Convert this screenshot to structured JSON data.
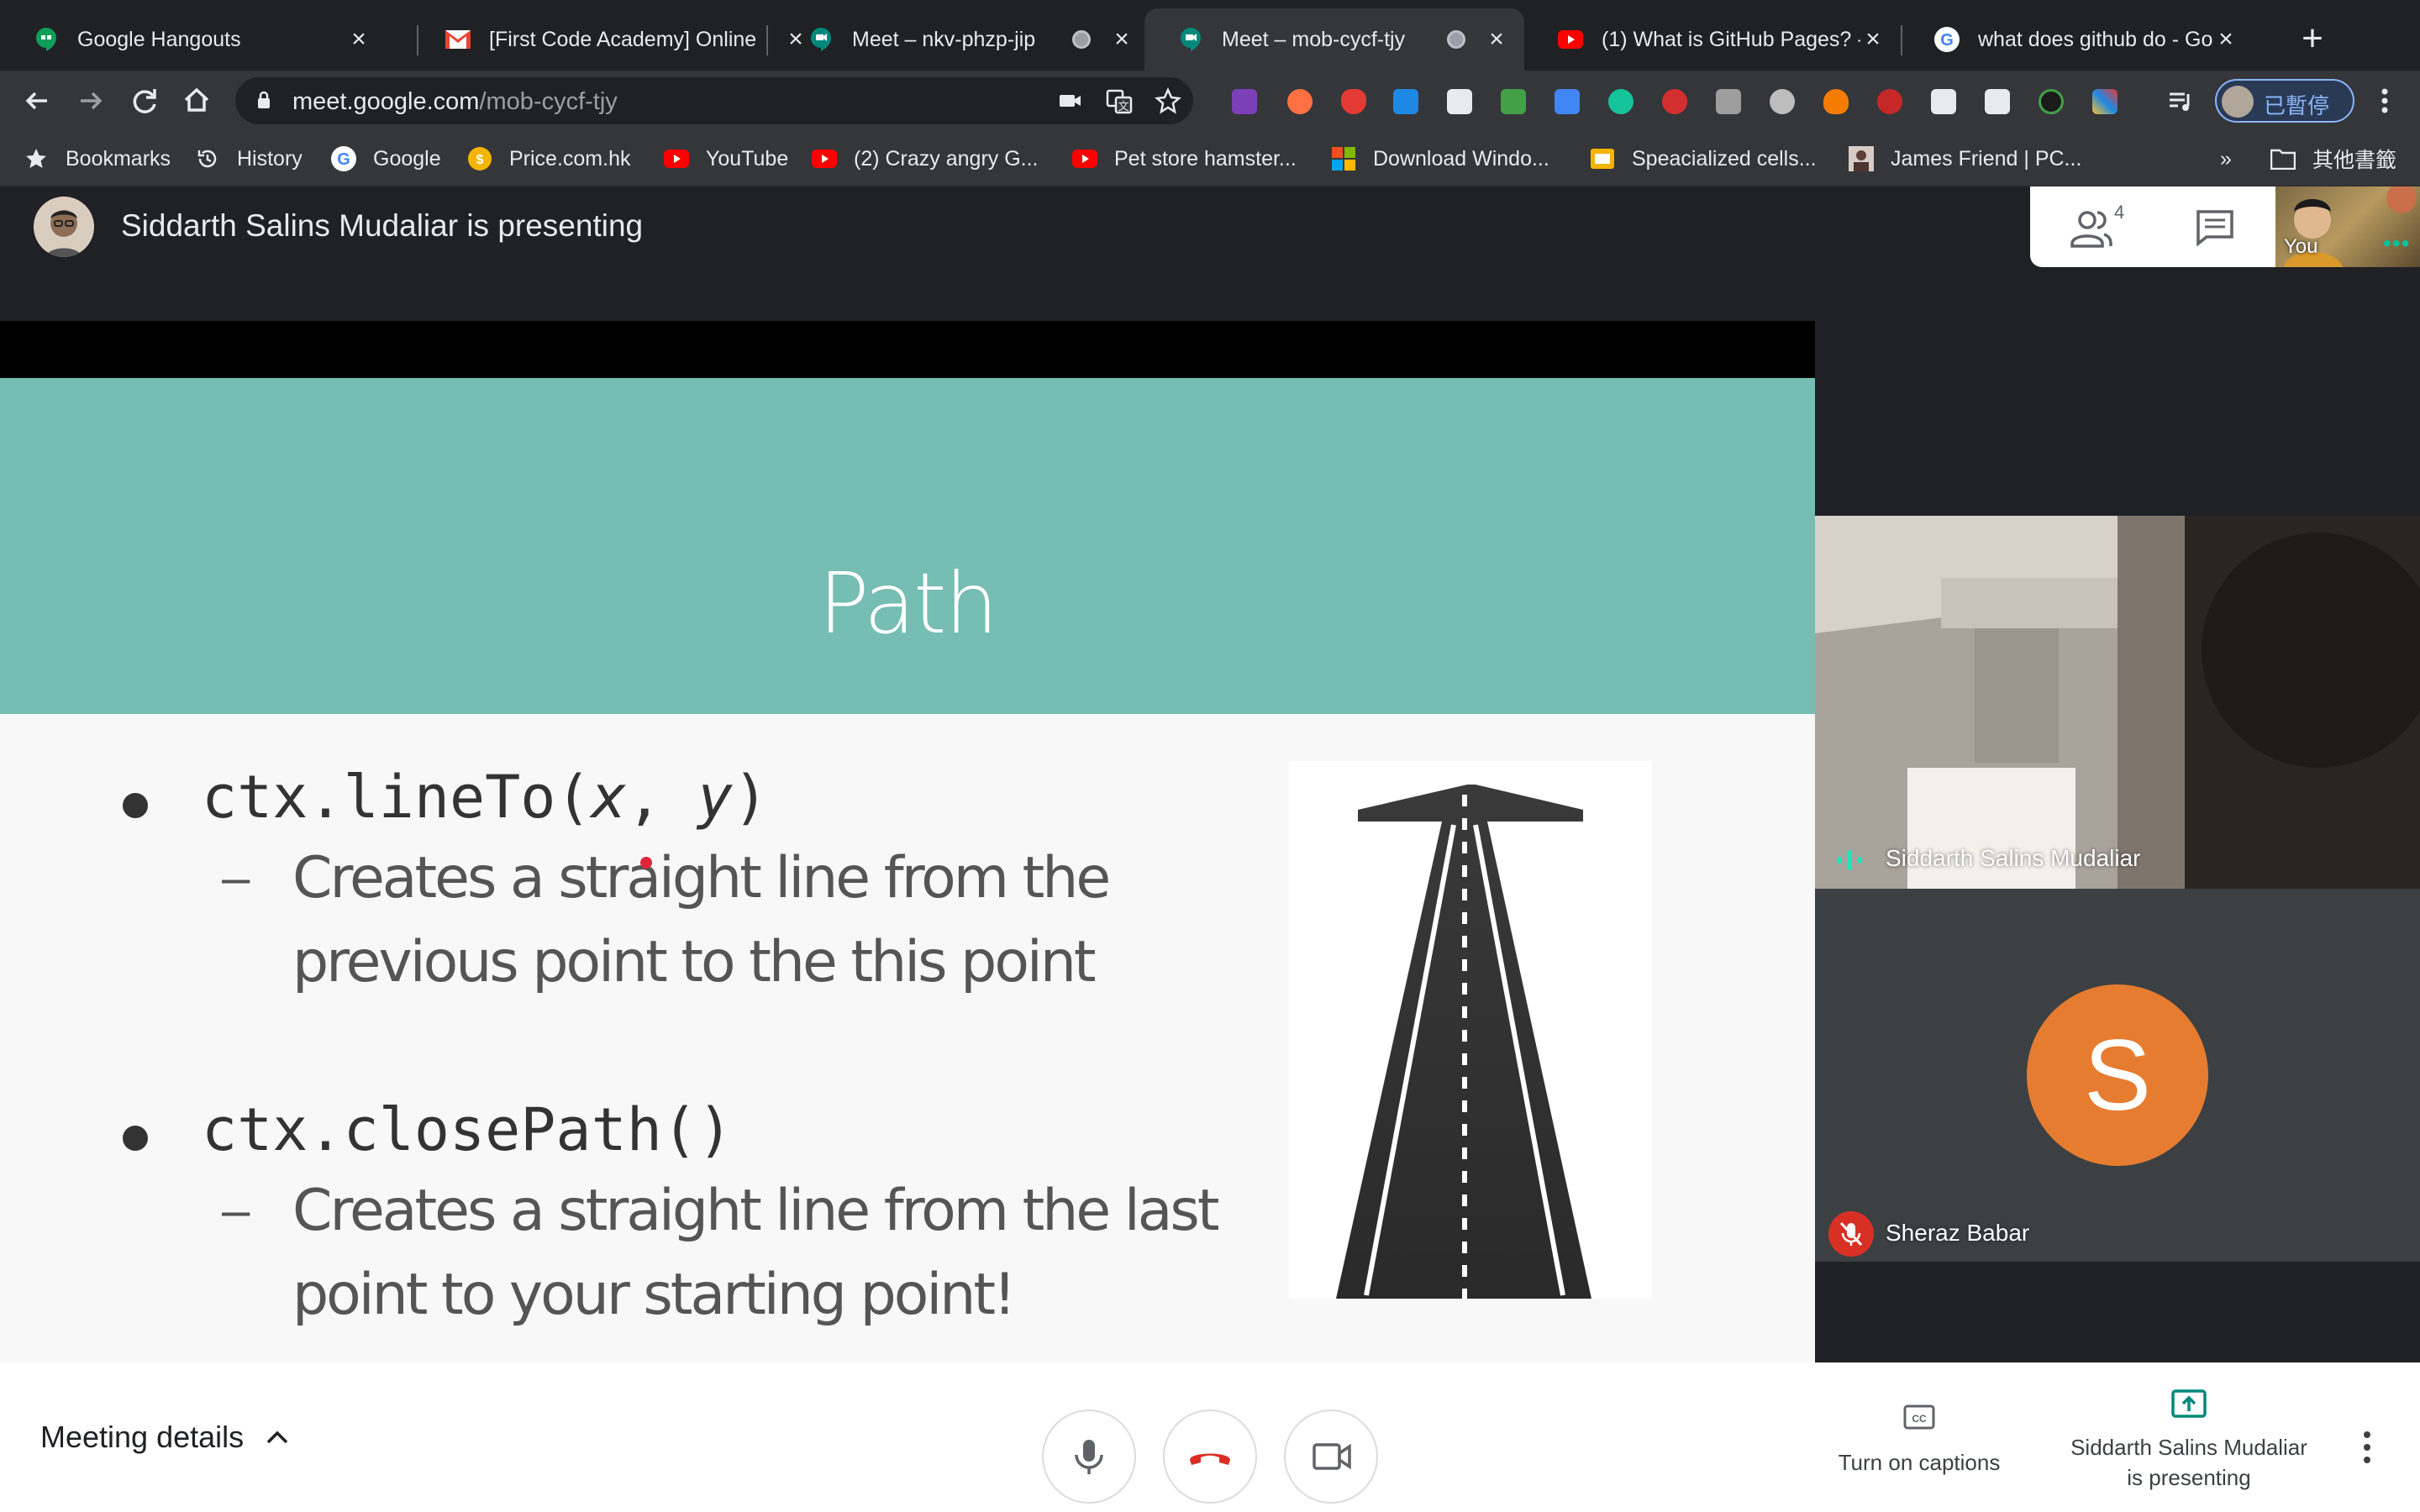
{
  "tabs": [
    {
      "title": "Google Hangouts",
      "icon": "hangouts-icon",
      "active": false
    },
    {
      "title": "[First Code Academy] Online",
      "icon": "gmail-icon",
      "active": false
    },
    {
      "title": "Meet – nkv-phzp-jip",
      "icon": "meet-icon",
      "active": false
    },
    {
      "title": "Meet – mob-cycf-tjy",
      "icon": "meet-icon",
      "active": true
    },
    {
      "title": "(1) What is GitHub Pages? -",
      "icon": "youtube-icon",
      "active": false
    },
    {
      "title": "what does github do - Goog",
      "icon": "google-icon",
      "active": false
    }
  ],
  "toolbar": {
    "url_host": "meet.google.com",
    "url_path": "/mob-cycf-tjy",
    "profile_label": "已暫停"
  },
  "bookmarks": {
    "items": [
      {
        "label": "Bookmarks",
        "icon": "star-icon"
      },
      {
        "label": "History",
        "icon": "history-icon"
      },
      {
        "label": "Google",
        "icon": "google-icon"
      },
      {
        "label": "Price.com.hk",
        "icon": "price-icon"
      },
      {
        "label": "YouTube",
        "icon": "youtube-icon"
      },
      {
        "label": "(2) Crazy angry G...",
        "icon": "youtube-icon"
      },
      {
        "label": "Pet store hamster...",
        "icon": "youtube-icon"
      },
      {
        "label": "Download Windo...",
        "icon": "windows-icon"
      },
      {
        "label": "Speacialized cells...",
        "icon": "slides-icon"
      },
      {
        "label": "James Friend | PC...",
        "icon": "photo-icon"
      }
    ],
    "overflow": "»",
    "other_label": "其他書籤"
  },
  "meet": {
    "presenter_text": "Siddarth Salins Mudaliar is presenting",
    "people_count": "4",
    "self_label": "You",
    "slide": {
      "title": "Path",
      "bullets": [
        {
          "code": "ctx.lineTo(x, y)",
          "code_prefix": "ctx.lineTo(",
          "arg1": "x",
          "sep": ", ",
          "arg2": "y",
          "code_suffix": ")",
          "lines": [
            "Creates a straight line from the",
            "previous point to the this point"
          ]
        },
        {
          "code": "ctx.closePath()",
          "lines": [
            "Creates a straight line from the last",
            "point to your starting point!"
          ]
        }
      ]
    },
    "participants": [
      {
        "name": "Siddarth Salins Mudaliar",
        "status": "speaking"
      },
      {
        "name": "Sheraz Babar",
        "initial": "S",
        "status": "muted",
        "avatar_color": "#e67c30"
      }
    ],
    "bottom": {
      "meeting_details": "Meeting details",
      "captions_label": "Turn on captions",
      "presenting_line1": "Siddarth Salins Mudaliar",
      "presenting_line2": "is presenting"
    }
  },
  "colors": {
    "slide_banner": "#76bdb3",
    "end_call_red": "#d93025",
    "meet_green": "#00897b",
    "chrome_dark": "#202124"
  }
}
